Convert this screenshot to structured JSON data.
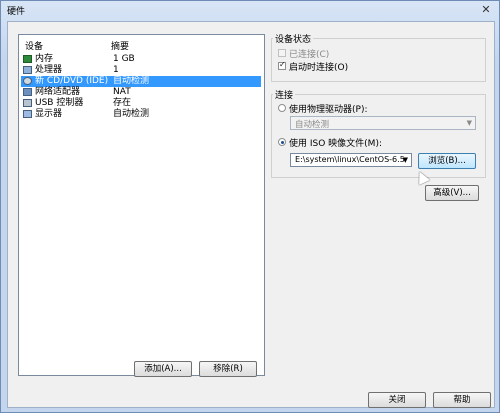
{
  "window": {
    "title": "硬件"
  },
  "device_list": {
    "headers": [
      "设备",
      "摘要"
    ],
    "rows": [
      {
        "icon": "memory-icon",
        "name": "内存",
        "summary": "1 GB",
        "selected": false
      },
      {
        "icon": "processor-icon",
        "name": "处理器",
        "summary": "1",
        "selected": false
      },
      {
        "icon": "cd-dvd-icon",
        "name": "新 CD/DVD (IDE)",
        "summary": "自动检测",
        "selected": true
      },
      {
        "icon": "network-adapter-icon",
        "name": "网络适配器",
        "summary": "NAT",
        "selected": false
      },
      {
        "icon": "usb-controller-icon",
        "name": "USB 控制器",
        "summary": "存在",
        "selected": false
      },
      {
        "icon": "display-icon",
        "name": "显示器",
        "summary": "自动检测",
        "selected": false
      }
    ]
  },
  "device_status": {
    "title": "设备状态",
    "connected_label": "已连接(C)",
    "connected_checked": false,
    "connect_at_power_on_label": "启动时连接(O)",
    "connect_at_power_on_checked": true
  },
  "connection": {
    "title": "连接",
    "physical_drive_label": "使用物理驱动器(P):",
    "physical_drive_value": "自动检测",
    "iso_label": "使用 ISO 映像文件(M):",
    "iso_path": "E:\\system\\linux\\CentOS-6.5",
    "browse_label": "浏览(B)...",
    "selected_option": "iso"
  },
  "advanced_label": "高级(V)...",
  "add_label": "添加(A)...",
  "remove_label": "移除(R)",
  "close_label": "关闭",
  "help_label": "帮助",
  "window_close_glyph": "✕"
}
